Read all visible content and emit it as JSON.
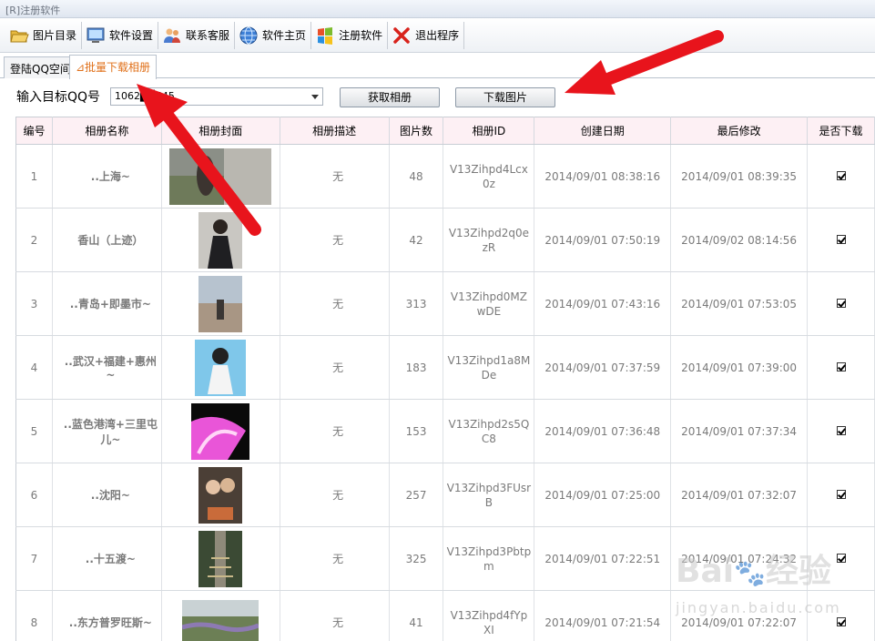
{
  "window": {
    "title": "[R]注册软件"
  },
  "toolbar": {
    "items": [
      {
        "label": "图片目录",
        "icon": "folder-open-icon"
      },
      {
        "label": "软件设置",
        "icon": "monitor-icon"
      },
      {
        "label": "联系客服",
        "icon": "users-icon"
      },
      {
        "label": "软件主页",
        "icon": "globe-icon"
      },
      {
        "label": "注册软件",
        "icon": "windows-logo-icon"
      },
      {
        "label": "退出程序",
        "icon": "close-icon"
      }
    ]
  },
  "tabs": [
    {
      "label": "登陆QQ空间",
      "active": false
    },
    {
      "label": "⊿批量下载相册",
      "active": true
    }
  ],
  "form": {
    "qq_label": "输入目标QQ号",
    "qq_value": "1062▉▉545",
    "get_album_button": "获取相册",
    "download_button": "下载图片"
  },
  "table": {
    "columns": [
      "编号",
      "相册名称",
      "相册封面",
      "相册描述",
      "图片数",
      "相册ID",
      "创建日期",
      "最后修改",
      "是否下载"
    ],
    "rows": [
      {
        "index": "1",
        "name": "..上海~",
        "cover": "photo-cover-1",
        "desc": "无",
        "count": "48",
        "album_id": "V13Zihpd4Lcx0z",
        "created": "2014/09/01 08:38:16",
        "modified": "2014/09/01 08:39:35",
        "download": true
      },
      {
        "index": "2",
        "name": "香山（上迹）",
        "cover": "photo-cover-2",
        "desc": "无",
        "count": "42",
        "album_id": "V13Zihpd2q0ezR",
        "created": "2014/09/01 07:50:19",
        "modified": "2014/09/02 08:14:56",
        "download": true
      },
      {
        "index": "3",
        "name": "..青岛+即墨市~",
        "cover": "photo-cover-3",
        "desc": "无",
        "count": "313",
        "album_id": "V13Zihpd0MZwDE",
        "created": "2014/09/01 07:43:16",
        "modified": "2014/09/01 07:53:05",
        "download": true
      },
      {
        "index": "4",
        "name": "..武汉+福建+惠州~",
        "cover": "photo-cover-4",
        "desc": "无",
        "count": "183",
        "album_id": "V13Zihpd1a8MDe",
        "created": "2014/09/01 07:37:59",
        "modified": "2014/09/01 07:39:00",
        "download": true
      },
      {
        "index": "5",
        "name": "..蓝色港湾+三里屯儿~",
        "cover": "photo-cover-5",
        "desc": "无",
        "count": "153",
        "album_id": "V13Zihpd2s5QC8",
        "created": "2014/09/01 07:36:48",
        "modified": "2014/09/01 07:37:34",
        "download": true
      },
      {
        "index": "6",
        "name": "..沈阳~",
        "cover": "photo-cover-6",
        "desc": "无",
        "count": "257",
        "album_id": "V13Zihpd3FUsrB",
        "created": "2014/09/01 07:25:00",
        "modified": "2014/09/01 07:32:07",
        "download": true
      },
      {
        "index": "7",
        "name": "..十五渡~",
        "cover": "photo-cover-7",
        "desc": "无",
        "count": "325",
        "album_id": "V13Zihpd3Pbtpm",
        "created": "2014/09/01 07:22:51",
        "modified": "2014/09/01 07:24:32",
        "download": true
      },
      {
        "index": "8",
        "name": "..东方普罗旺斯~",
        "cover": "photo-cover-8",
        "desc": "无",
        "count": "41",
        "album_id": "V13Zihpd4fYpXI",
        "created": "2014/09/01 07:21:54",
        "modified": "2014/09/01 07:22:07",
        "download": true
      }
    ]
  },
  "watermark": {
    "text": "Bai du 经验",
    "sub": "jingyan.baidu.com"
  },
  "colors": {
    "accent_red": "#d9262c",
    "arrow_red": "#e8141c",
    "header_bg": "#fdf0f4",
    "tab_active_text": "#e0701a"
  }
}
